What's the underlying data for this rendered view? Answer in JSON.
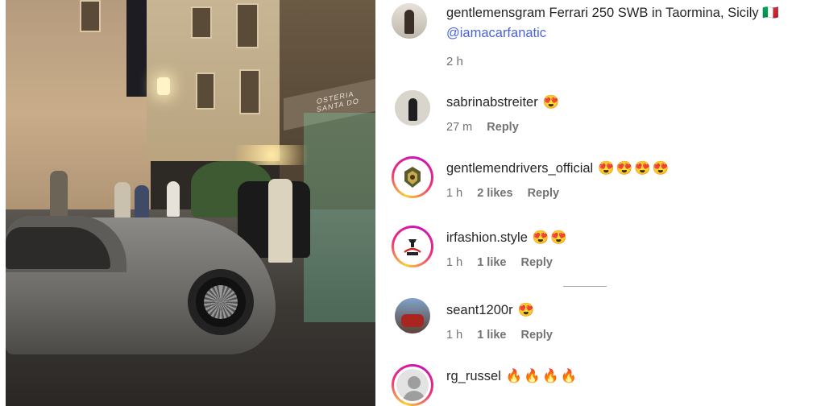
{
  "post": {
    "username": "gentlemensgram",
    "caption": "Ferrari 250 SWB in Taormina, Sicily",
    "flag": "🇮🇹",
    "mention": "@iamacarfanatic",
    "time": "2 h"
  },
  "photo": {
    "sign_text": "OSTERIA SANTA DO"
  },
  "comments": [
    {
      "username": "sabrinabstreiter",
      "emoji": "😍",
      "time": "27 m",
      "likes": "",
      "reply": "Reply",
      "avatar": "photo",
      "ring": false
    },
    {
      "username": "gentlemendrivers_official",
      "emoji": "😍😍😍😍",
      "time": "1 h",
      "likes": "2 likes",
      "reply": "Reply",
      "avatar": "emblem",
      "ring": true
    },
    {
      "username": "irfashion.style",
      "emoji": "😍😍",
      "time": "1 h",
      "likes": "1 like",
      "reply": "Reply",
      "avatar": "logo",
      "ring": true
    },
    {
      "username": "seant1200r",
      "emoji": "😍",
      "time": "1 h",
      "likes": "1 like",
      "reply": "Reply",
      "avatar": "photo",
      "ring": false
    },
    {
      "username": "rg_russel",
      "emoji": "🔥🔥🔥🔥",
      "time": "",
      "likes": "",
      "reply": "",
      "avatar": "default-user",
      "ring": true
    }
  ],
  "colors": {
    "mention": "#4a64d8",
    "meta": "#737373",
    "text": "#262626",
    "story_ring": [
      "#f9ce34",
      "#ee2a7b",
      "#c913b9"
    ]
  }
}
